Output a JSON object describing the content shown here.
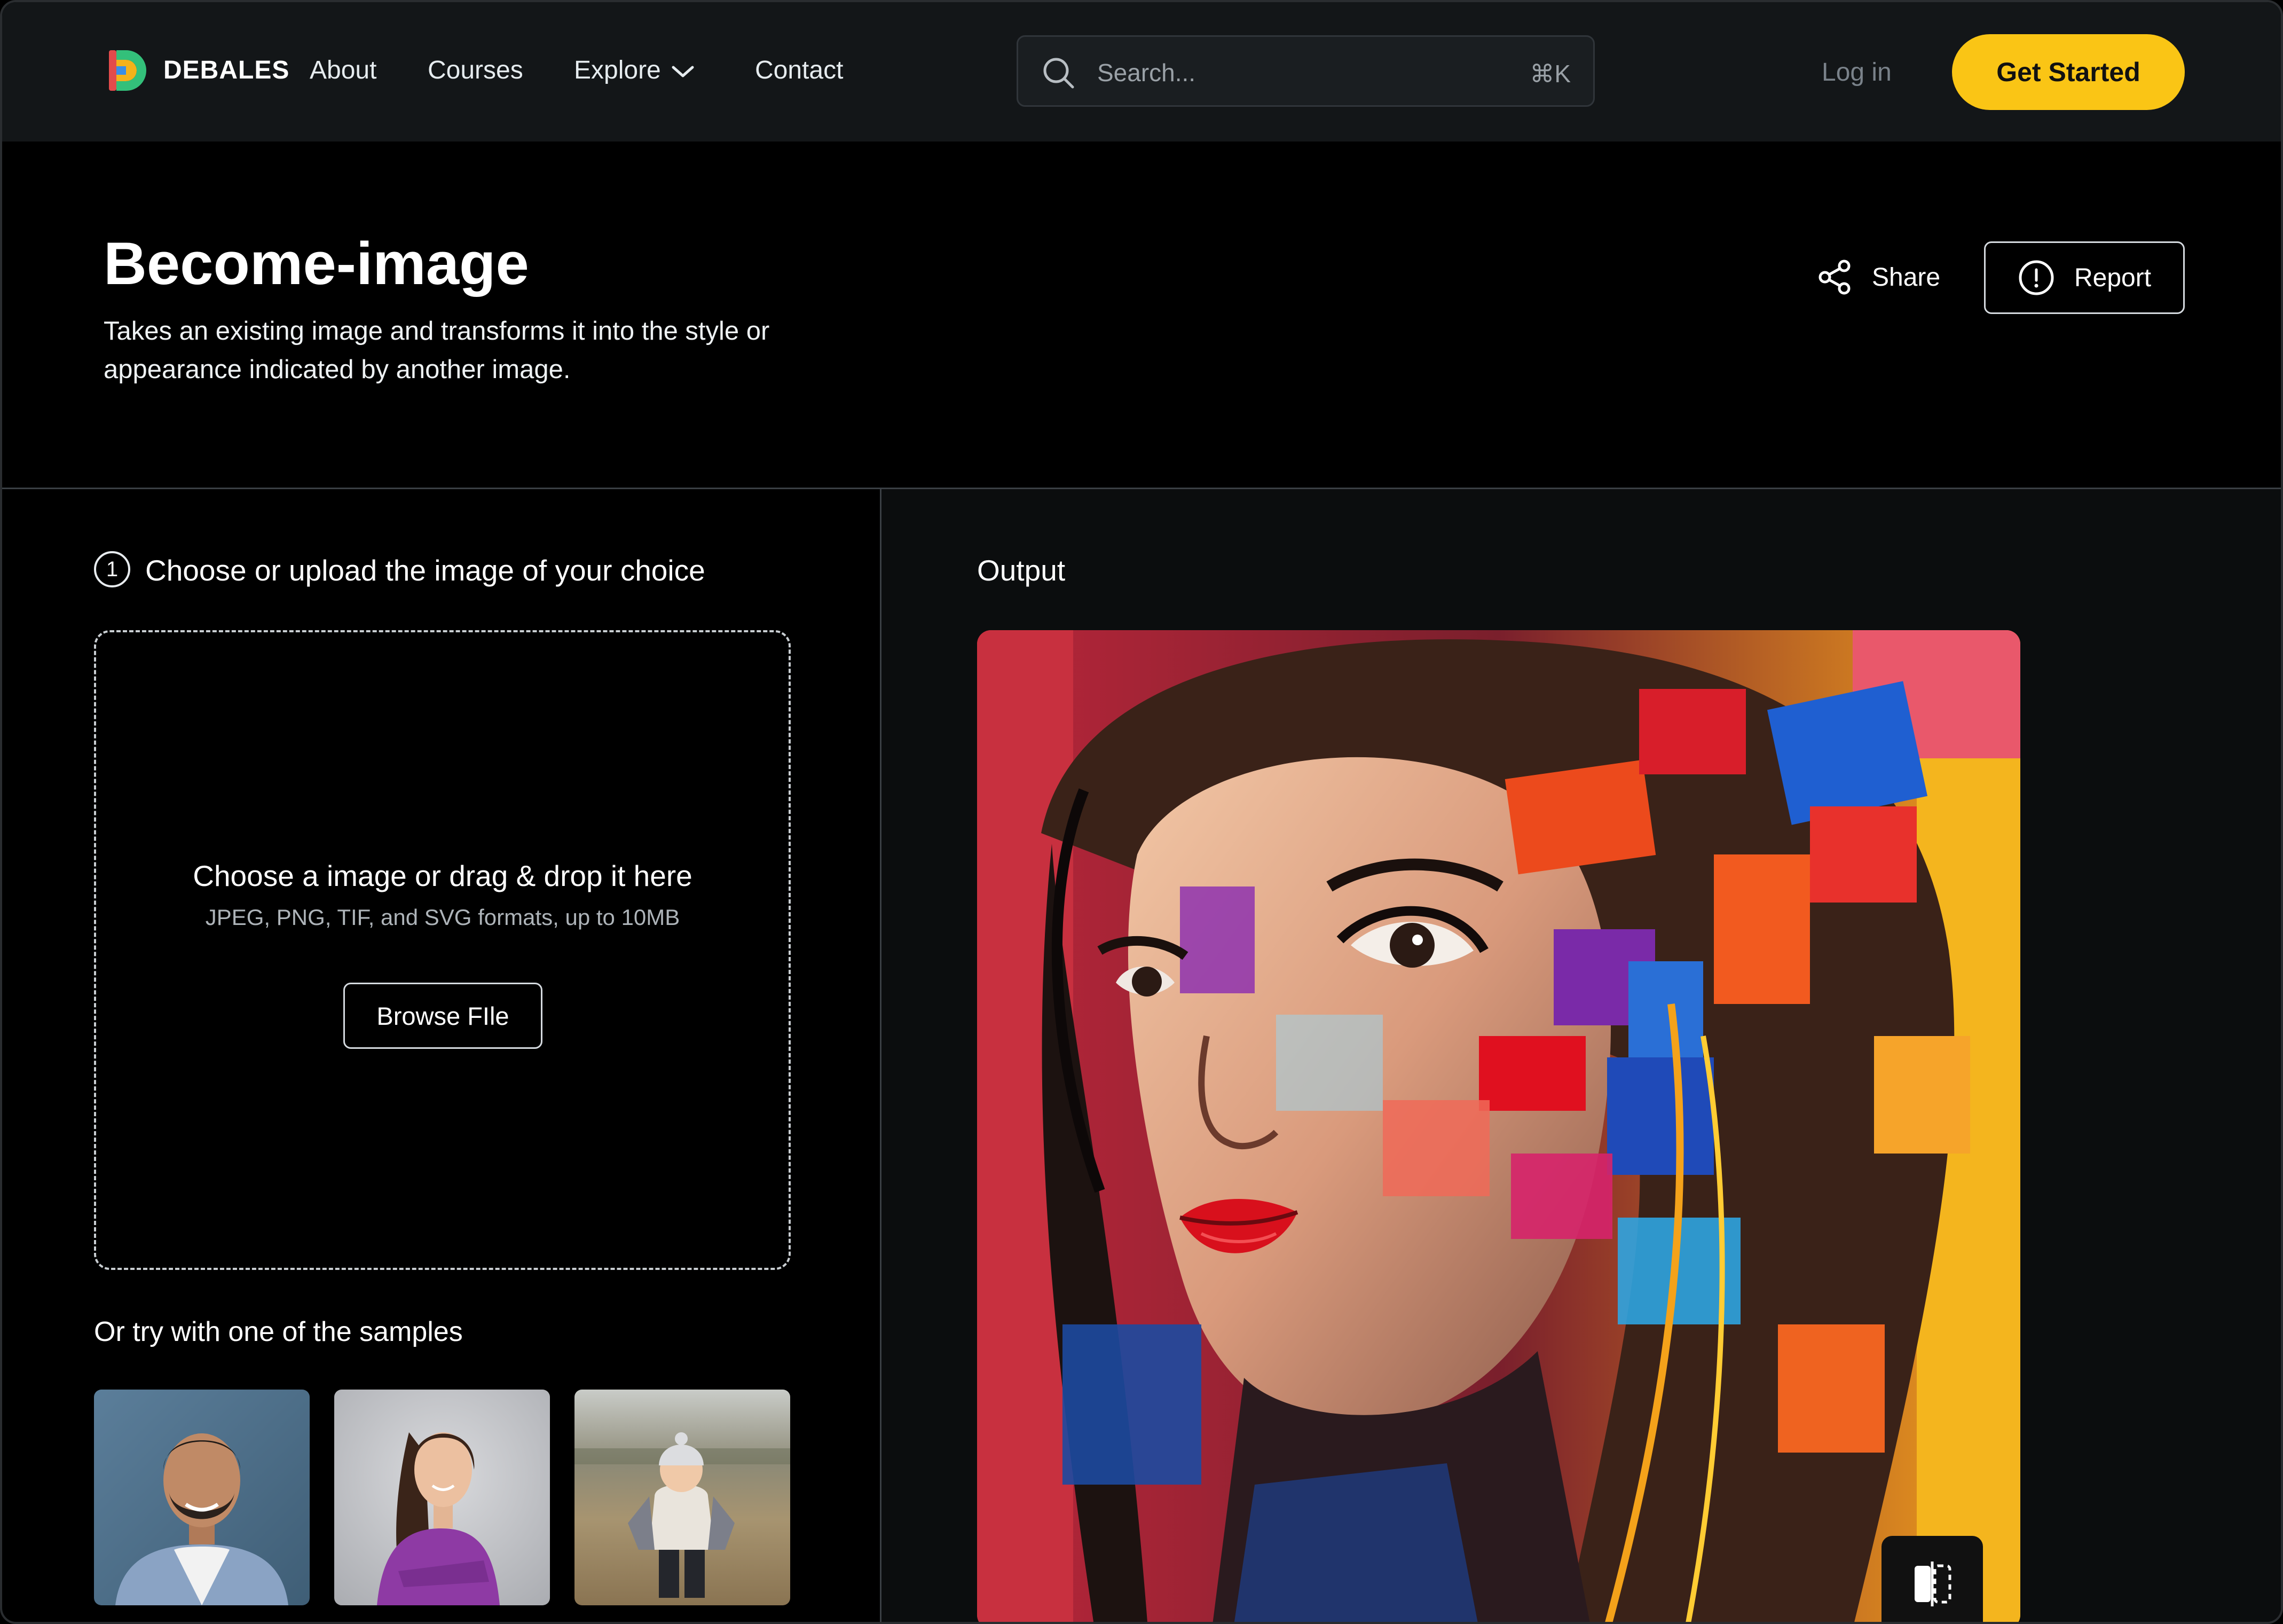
{
  "nav": {
    "brand": "DEBALES",
    "links": [
      "About",
      "Courses",
      "Explore",
      "Contact"
    ],
    "search_placeholder": "Search...",
    "search_shortcut": "⌘K",
    "login": "Log in",
    "cta": "Get Started"
  },
  "header": {
    "title": "Become-image",
    "description": "Takes an existing image and transforms it into the style or appearance indicated by another image.",
    "share": "Share",
    "report": "Report"
  },
  "input_panel": {
    "step_number": "1",
    "step_title": "Choose or upload the image of your choice",
    "dropzone_title": "Choose a image or drag & drop it here",
    "dropzone_subtitle": "JPEG, PNG, TIF, and SVG formats, up to 10MB",
    "browse_label": "Browse FIle",
    "samples_title": "Or try with one of the samples"
  },
  "output_panel": {
    "label": "Output"
  },
  "colors": {
    "accent": "#fac515",
    "nav_bg": "#131618",
    "panel_bg": "#0b0d0e"
  },
  "icons": [
    "logo-icon",
    "chevron-down-icon",
    "search-icon",
    "share-icon",
    "alert-circle-icon",
    "compare-icon"
  ]
}
